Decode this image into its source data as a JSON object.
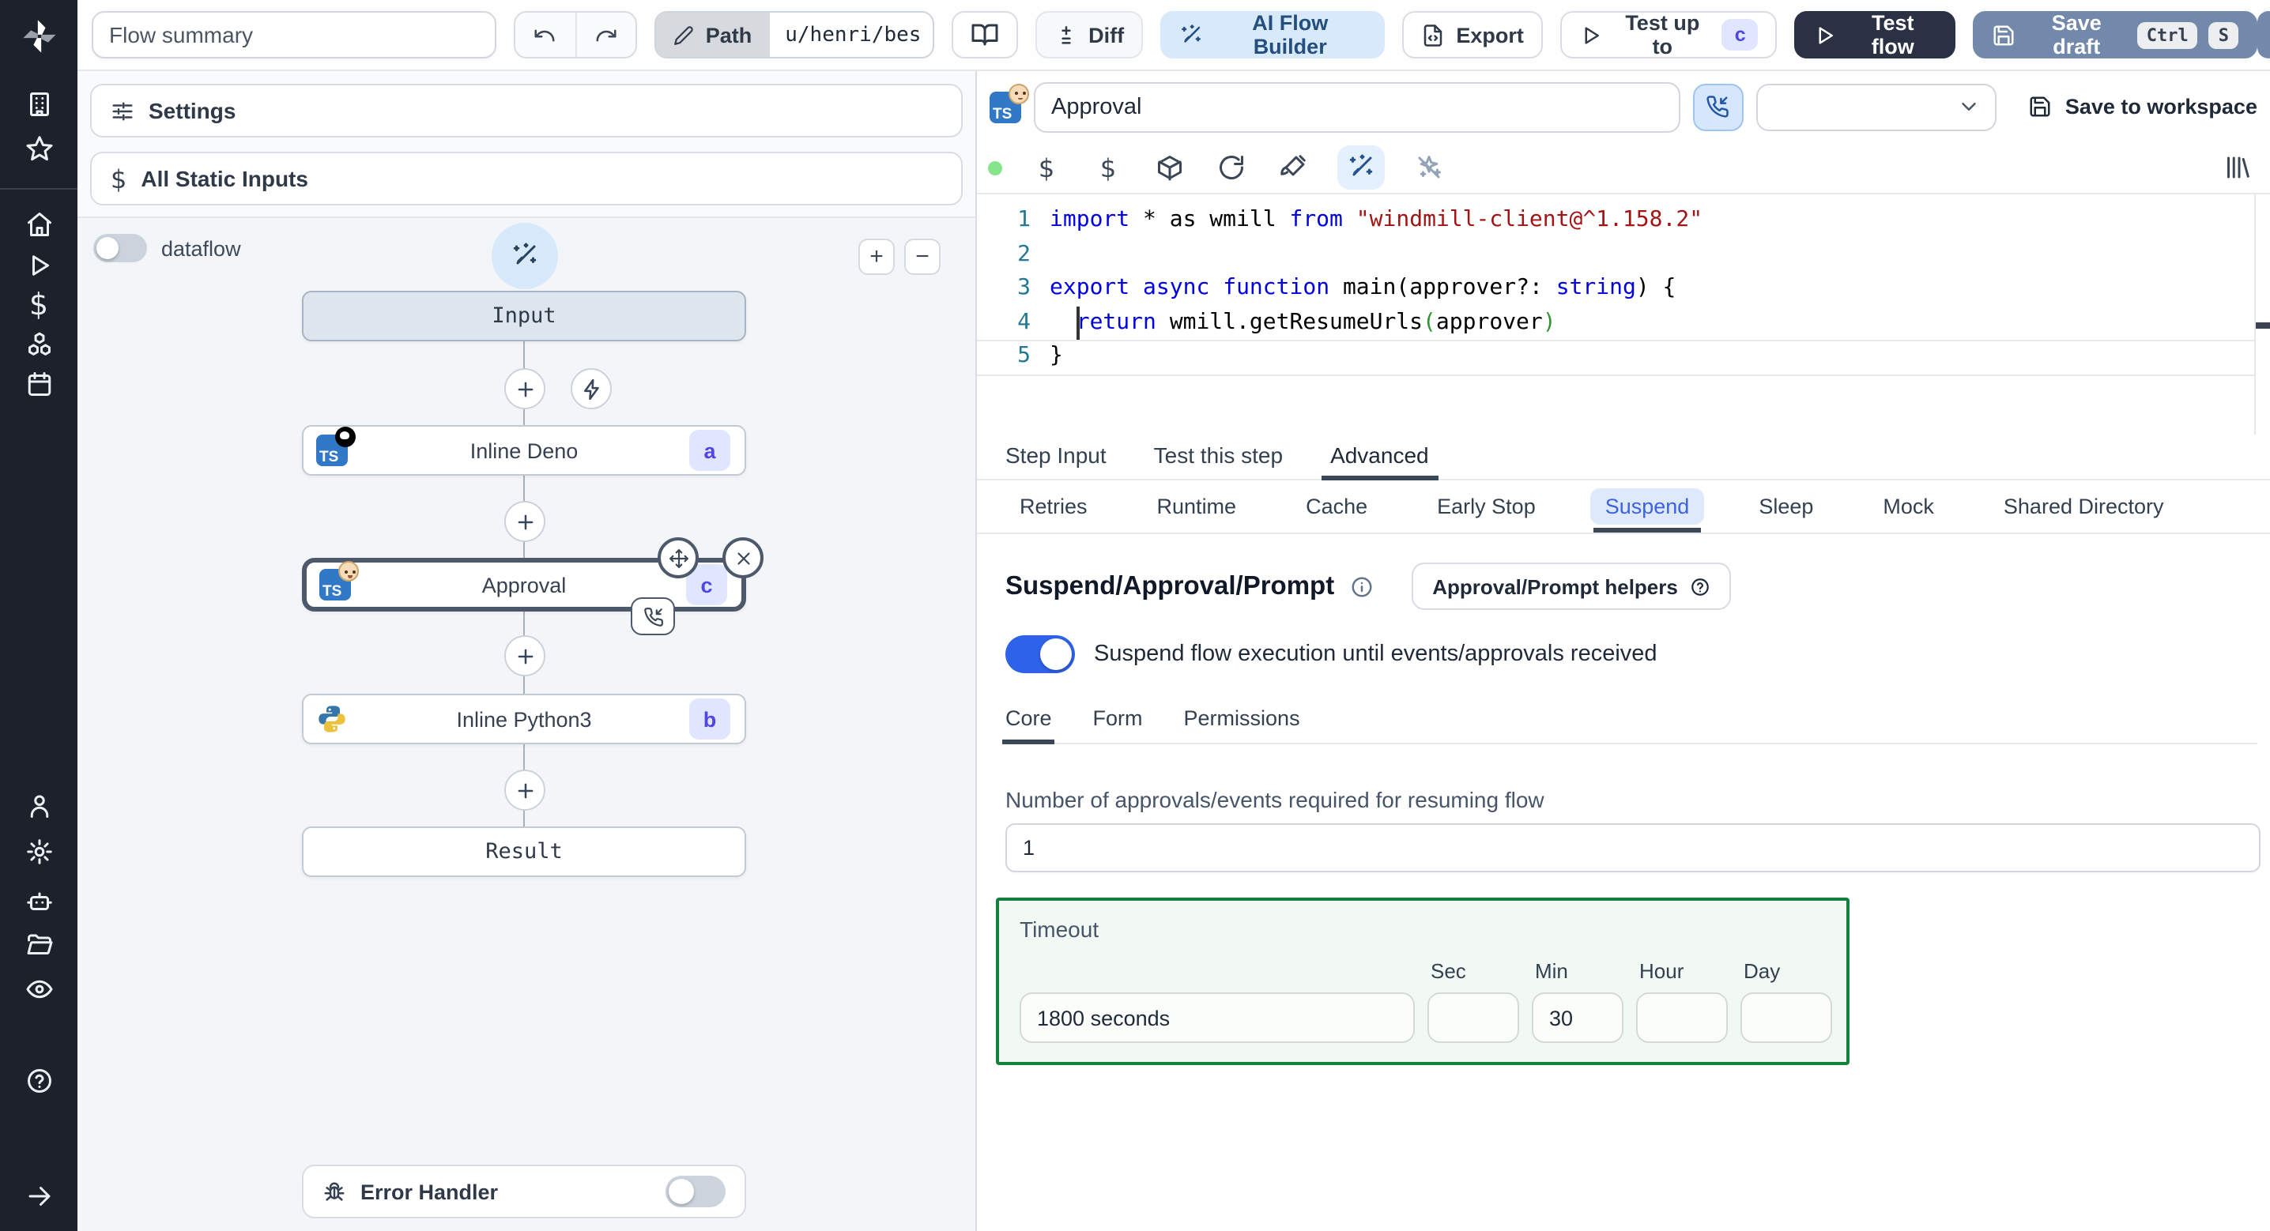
{
  "topbar": {
    "flow_summary": "Flow summary",
    "path_label": "Path",
    "path_value": "u/henri/bes",
    "diff_label": "Diff",
    "ai_builder_label": "AI Flow Builder",
    "export_label": "Export",
    "test_up_to_label": "Test up to",
    "test_up_to_badge": "c",
    "test_flow_label": "Test flow",
    "save_draft_label": "Save draft",
    "kbd_ctrl": "Ctrl",
    "kbd_s": "S"
  },
  "left_panel": {
    "settings_label": "Settings",
    "static_inputs_label": "All Static Inputs",
    "dataflow_label": "dataflow",
    "nodes": {
      "input_label": "Input",
      "deno_label": "Inline Deno",
      "deno_badge": "a",
      "approval_label": "Approval",
      "approval_badge": "c",
      "python_label": "Inline Python3",
      "python_badge": "b",
      "result_label": "Result"
    },
    "error_handler_label": "Error Handler"
  },
  "right_panel": {
    "step_name": "Approval",
    "save_to_workspace_label": "Save to workspace",
    "code": {
      "lines": [
        {
          "no": "1",
          "tokens": [
            [
              "kw",
              "import"
            ],
            [
              "pl",
              " * as wmill "
            ],
            [
              "kw",
              "from"
            ],
            [
              "pl",
              " "
            ],
            [
              "str",
              "\"windmill-client@^1.158.2\""
            ]
          ]
        },
        {
          "no": "2",
          "tokens": []
        },
        {
          "no": "3",
          "tokens": [
            [
              "kw",
              "export"
            ],
            [
              "pl",
              " "
            ],
            [
              "kw",
              "async"
            ],
            [
              "pl",
              " "
            ],
            [
              "kw",
              "function"
            ],
            [
              "pl",
              " main(approver?: "
            ],
            [
              "kw",
              "string"
            ],
            [
              "pl",
              ") {"
            ]
          ]
        },
        {
          "no": "4",
          "tokens": [
            [
              "pl",
              "  "
            ],
            [
              "kw",
              "return"
            ],
            [
              "pl",
              " wmill.getResumeUrls"
            ],
            [
              "brk",
              "("
            ],
            [
              "pl",
              "approver"
            ],
            [
              "brk",
              ")"
            ]
          ]
        },
        {
          "no": "5",
          "tokens": [
            [
              "pl",
              "}"
            ]
          ]
        }
      ]
    },
    "tabs": [
      "Step Input",
      "Test this step",
      "Advanced"
    ],
    "active_tab": "Advanced",
    "subtabs": [
      "Retries",
      "Runtime",
      "Cache",
      "Early Stop",
      "Suspend",
      "Sleep",
      "Mock",
      "Shared Directory"
    ],
    "active_subtab": "Suspend",
    "suspend": {
      "heading": "Suspend/Approval/Prompt",
      "helpers_button": "Approval/Prompt helpers",
      "toggle_label": "Suspend flow execution until events/approvals received",
      "toggle_on": true,
      "inner_tabs": [
        "Core",
        "Form",
        "Permissions"
      ],
      "active_inner_tab": "Core",
      "approvals_label": "Number of approvals/events required for resuming flow",
      "approvals_value": "1",
      "timeout": {
        "label": "Timeout",
        "value": "1800 seconds",
        "unit_labels": [
          "Sec",
          "Min",
          "Hour",
          "Day"
        ],
        "sec": "",
        "min": "30",
        "hour": "",
        "day": ""
      }
    }
  },
  "icons": [
    "windmill-logo",
    "building-icon",
    "star-icon",
    "home-icon",
    "play-icon",
    "dollar-icon",
    "boxes-icon",
    "calendar-icon",
    "user-icon",
    "gear-icon",
    "bot-icon",
    "folder-icon",
    "eye-icon",
    "help-icon",
    "arrow-right-icon",
    "undo-icon",
    "redo-icon",
    "pencil-icon",
    "book-open-icon",
    "diff-icon",
    "wand-icon",
    "file-code-icon",
    "save-icon",
    "sliders-icon",
    "lightning-icon",
    "plus-icon",
    "minus-icon",
    "move-icon",
    "close-icon",
    "phone-incoming-icon",
    "bug-icon",
    "chevron-down-icon",
    "info-icon",
    "help-circle-icon",
    "package-icon",
    "refresh-icon",
    "paintbrush-icon",
    "sparkles-icon",
    "library-icon",
    "status-dot-green"
  ],
  "colors": {
    "accent_blue": "#2f62ea",
    "toggle_on_blue": "#2f62ea",
    "timeout_border_green": "#15803d",
    "badge_bg": "#e0e6fd",
    "badge_text": "#4f46e5",
    "save_draft_bg": "#7389ab",
    "test_flow_bg": "#2a3142",
    "ai_builder_bg": "#d8e9fc",
    "code_keyword": "#0000e0",
    "code_string": "#a31515",
    "status_green": "#86e58b",
    "sidebar_bg": "#1d212b"
  }
}
